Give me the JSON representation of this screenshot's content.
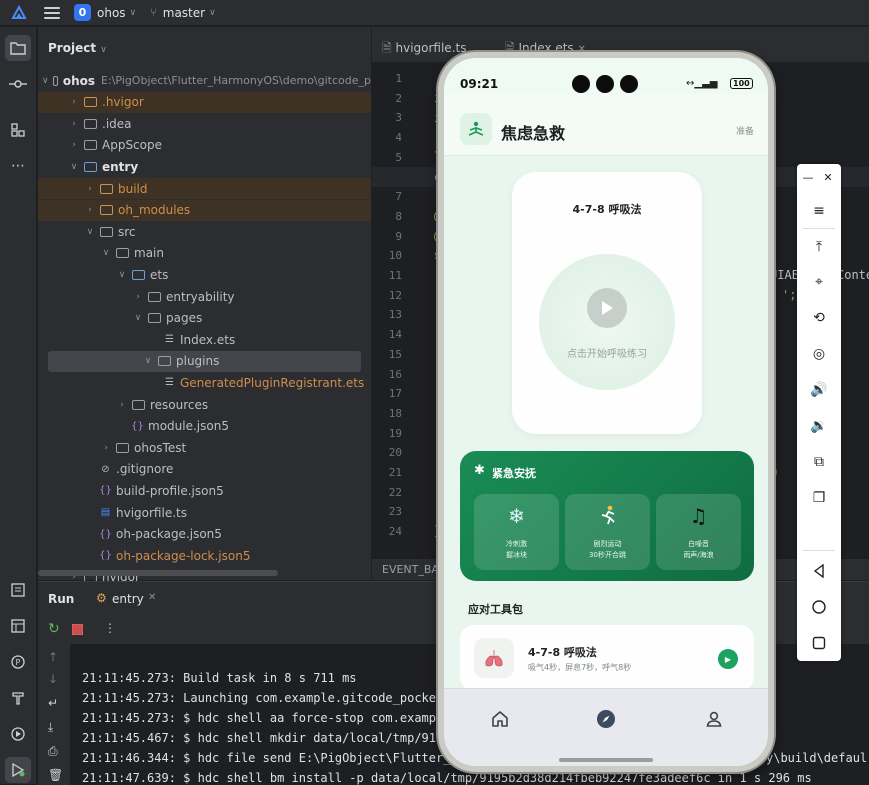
{
  "titlebar": {
    "project_badge": "0",
    "project_name": "ohos",
    "branch": "master"
  },
  "project_panel": {
    "header": "Project",
    "tree": [
      {
        "label": "ohos",
        "extra": "E:\\PigObject\\Flutter_HarmonyOS\\demo\\gitcode_p",
        "indent": 0,
        "arrow": "open",
        "type": "folder",
        "style": "root"
      },
      {
        "label": ".hvigor",
        "indent": 1,
        "arrow": "closed",
        "type": "folder-orange",
        "style": "excluded"
      },
      {
        "label": ".idea",
        "indent": 1,
        "arrow": "closed",
        "type": "folder",
        "style": ""
      },
      {
        "label": "AppScope",
        "indent": 1,
        "arrow": "closed",
        "type": "folder",
        "style": ""
      },
      {
        "label": "entry",
        "indent": 1,
        "arrow": "open",
        "type": "folder-blue",
        "style": "bold"
      },
      {
        "label": "build",
        "indent": 2,
        "arrow": "closed",
        "type": "folder-orange",
        "style": "excluded"
      },
      {
        "label": "oh_modules",
        "indent": 2,
        "arrow": "closed",
        "type": "folder-orange",
        "style": "excluded"
      },
      {
        "label": "src",
        "indent": 2,
        "arrow": "open",
        "type": "folder",
        "style": ""
      },
      {
        "label": "main",
        "indent": 3,
        "arrow": "open",
        "type": "folder",
        "style": ""
      },
      {
        "label": "ets",
        "indent": 4,
        "arrow": "open",
        "type": "folder-blue",
        "style": ""
      },
      {
        "label": "entryability",
        "indent": 5,
        "arrow": "closed",
        "type": "folder",
        "style": ""
      },
      {
        "label": "pages",
        "indent": 5,
        "arrow": "open",
        "type": "folder",
        "style": ""
      },
      {
        "label": "Index.ets",
        "indent": 6,
        "arrow": "",
        "type": "file",
        "style": ""
      },
      {
        "label": "plugins",
        "indent": 5,
        "arrow": "open",
        "type": "folder",
        "style": "selected"
      },
      {
        "label": "GeneratedPluginRegistrant.ets",
        "indent": 6,
        "arrow": "",
        "type": "file",
        "style": "orange"
      },
      {
        "label": "resources",
        "indent": 4,
        "arrow": "closed",
        "type": "folder",
        "style": ""
      },
      {
        "label": "module.json5",
        "indent": 4,
        "arrow": "",
        "type": "json",
        "style": ""
      },
      {
        "label": "ohosTest",
        "indent": 3,
        "arrow": "closed",
        "type": "folder",
        "style": ""
      },
      {
        "label": ".gitignore",
        "indent": 2,
        "arrow": "",
        "type": "ignore",
        "style": ""
      },
      {
        "label": "build-profile.json5",
        "indent": 2,
        "arrow": "",
        "type": "json",
        "style": ""
      },
      {
        "label": "hvigorfile.ts",
        "indent": 2,
        "arrow": "",
        "type": "ts",
        "style": ""
      },
      {
        "label": "oh-package.json5",
        "indent": 2,
        "arrow": "",
        "type": "json",
        "style": ""
      },
      {
        "label": "oh-package-lock.json5",
        "indent": 2,
        "arrow": "",
        "type": "json",
        "style": "orange"
      },
      {
        "label": "hvigor",
        "indent": 1,
        "arrow": "closed",
        "type": "folder",
        "style": ""
      }
    ]
  },
  "editor": {
    "tabs": [
      {
        "label": "hvigorfile.ts"
      },
      {
        "label": "Index.ets"
      }
    ],
    "line_numbers": [
      "1",
      "2",
      "3",
      "4",
      "5",
      "6",
      "7",
      "8",
      "9",
      "10",
      "11",
      "12",
      "13",
      "14",
      "15",
      "16",
      "17",
      "18",
      "19",
      "20",
      "21",
      "22",
      "23",
      "24"
    ],
    "event_bar": "EVENT_BAC",
    "right_fragments": [
      "UIAE",
      "Conte"
    ]
  },
  "run_panel": {
    "title": "Run",
    "tab": "entry",
    "log": [
      "21:11:45.273: Build task in 8 s 711 ms",
      "21:11:45.273: Launching com.example.gitcode_pocket",
      "21:11:45.273: $ hdc shell aa force-stop com.exampl",
      "21:11:45.467: $ hdc shell mkdir data/local/tmp/919",
      "21:11:46.344: $ hdc file send E:\\PigObject\\Flutter_",
      "21:11:47.639: $ hdc shell bm install -p data/local/tmp/9195b2d38d214fbeb92247fe3adeef6c in 1 s 296 ms"
    ],
    "log_tail": "y\\build\\defaul"
  },
  "phone": {
    "time": "09:21",
    "battery": "100",
    "app_title": "焦虑急救",
    "app_state": "准备",
    "breath_title": "4-7-8 呼吸法",
    "breath_hint": "点击开始呼吸练习",
    "emergency": {
      "title": "紧急安抚",
      "items": [
        {
          "icon": "snowflake-icon",
          "line1": "冷刺激",
          "line2": "握冰块"
        },
        {
          "icon": "runner-icon",
          "line1": "剧烈运动",
          "line2": "30秒开合跳"
        },
        {
          "icon": "music-icon",
          "line1": "白噪音",
          "line2": "雨声/海浪"
        }
      ]
    },
    "toolkit_title": "应对工具包",
    "tool": {
      "title": "4-7-8 呼吸法",
      "subtitle": "吸气4秒，屏息7秒，呼气8秒"
    }
  },
  "colors": {
    "accent": "#1da35f",
    "emergency_bg": "#13804b",
    "ide_bg": "#1e1f22",
    "panel_bg": "#2b2d30"
  }
}
